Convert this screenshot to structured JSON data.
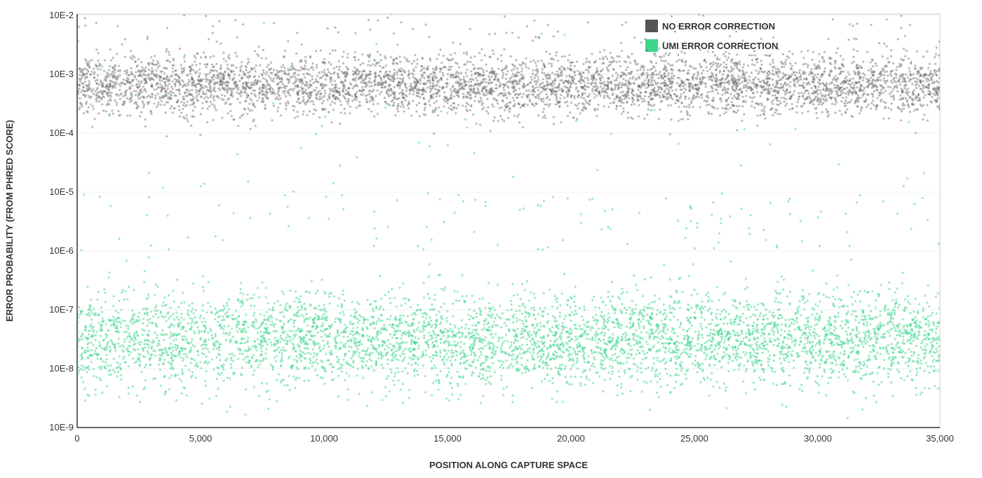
{
  "chart": {
    "title": "",
    "xAxis": {
      "label": "POSITION ALONG CAPTURE SPACE",
      "ticks": [
        "0",
        "5,000",
        "10,000",
        "15,000",
        "20,000",
        "25,000",
        "30,000",
        "35,000"
      ]
    },
    "yAxis": {
      "label": "ERROR PROBABILITY (FROM PHRED SCORE)",
      "ticks": [
        "10E-9",
        "10E-8",
        "10E-7",
        "10E-6",
        "10E-5",
        "10E-4",
        "10E-3",
        "10E-2"
      ]
    },
    "legend": {
      "items": [
        {
          "label": "NO ERROR CORRECTION",
          "color": "#555555"
        },
        {
          "label": "UMI ERROR CORRECTION",
          "color": "#3dd68c"
        }
      ]
    }
  }
}
